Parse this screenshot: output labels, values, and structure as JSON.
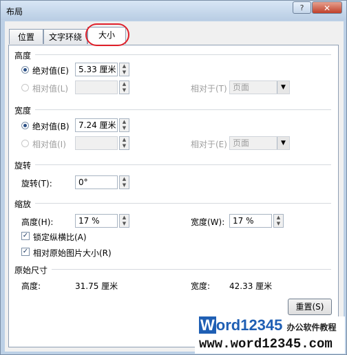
{
  "window": {
    "title": "布局",
    "help": "?",
    "close": "✕"
  },
  "tabs": [
    {
      "label": "位置"
    },
    {
      "label": "文字环绕"
    },
    {
      "label": "大小"
    }
  ],
  "height": {
    "section": "高度",
    "absolute_label": "绝对值(E)",
    "absolute_value": "5.33 厘米",
    "relative_label": "相对值(L)",
    "relative_to_label": "相对于(T)",
    "relative_to_value": "页面"
  },
  "width": {
    "section": "宽度",
    "absolute_label": "绝对值(B)",
    "absolute_value": "7.24 厘米",
    "relative_label": "相对值(I)",
    "relative_to_label": "相对于(E)",
    "relative_to_value": "页面"
  },
  "rotation": {
    "section": "旋转",
    "label": "旋转(T):",
    "value": "0°"
  },
  "scale": {
    "section": "缩放",
    "height_label": "高度(H):",
    "height_value": "17 %",
    "width_label": "宽度(W):",
    "width_value": "17 %",
    "lock_aspect_label": "锁定纵横比(A)",
    "relative_original_label": "相对原始图片大小(R)"
  },
  "original": {
    "section": "原始尺寸",
    "height_label": "高度:",
    "height_value": "31.75 厘米",
    "width_label": "宽度:",
    "width_value": "42.33 厘米"
  },
  "reset_button": "重置(S)",
  "watermark": {
    "brand_w": "W",
    "brand_rest": "ord12345",
    "brand_suffix": "办公软件教程",
    "url": "www.word12345.com"
  },
  "colors": {
    "accent": "#2a4f86",
    "highlight": "#e0202a",
    "watermark_blue": "#1f5fb4"
  }
}
